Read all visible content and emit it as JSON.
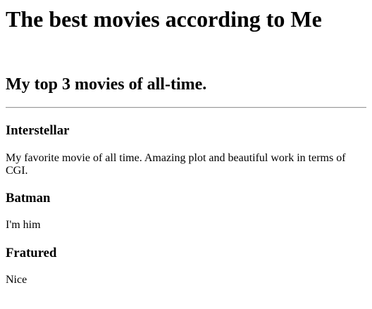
{
  "page": {
    "title": "The best movies according to Me",
    "subtitle": "My top 3 movies of all-time."
  },
  "movies": [
    {
      "name": "Interstellar",
      "description": "My favorite movie of all time. Amazing plot and beautiful work in terms of CGI."
    },
    {
      "name": "Batman",
      "description": "I'm him"
    },
    {
      "name": "Fratured",
      "description": "Nice"
    }
  ]
}
